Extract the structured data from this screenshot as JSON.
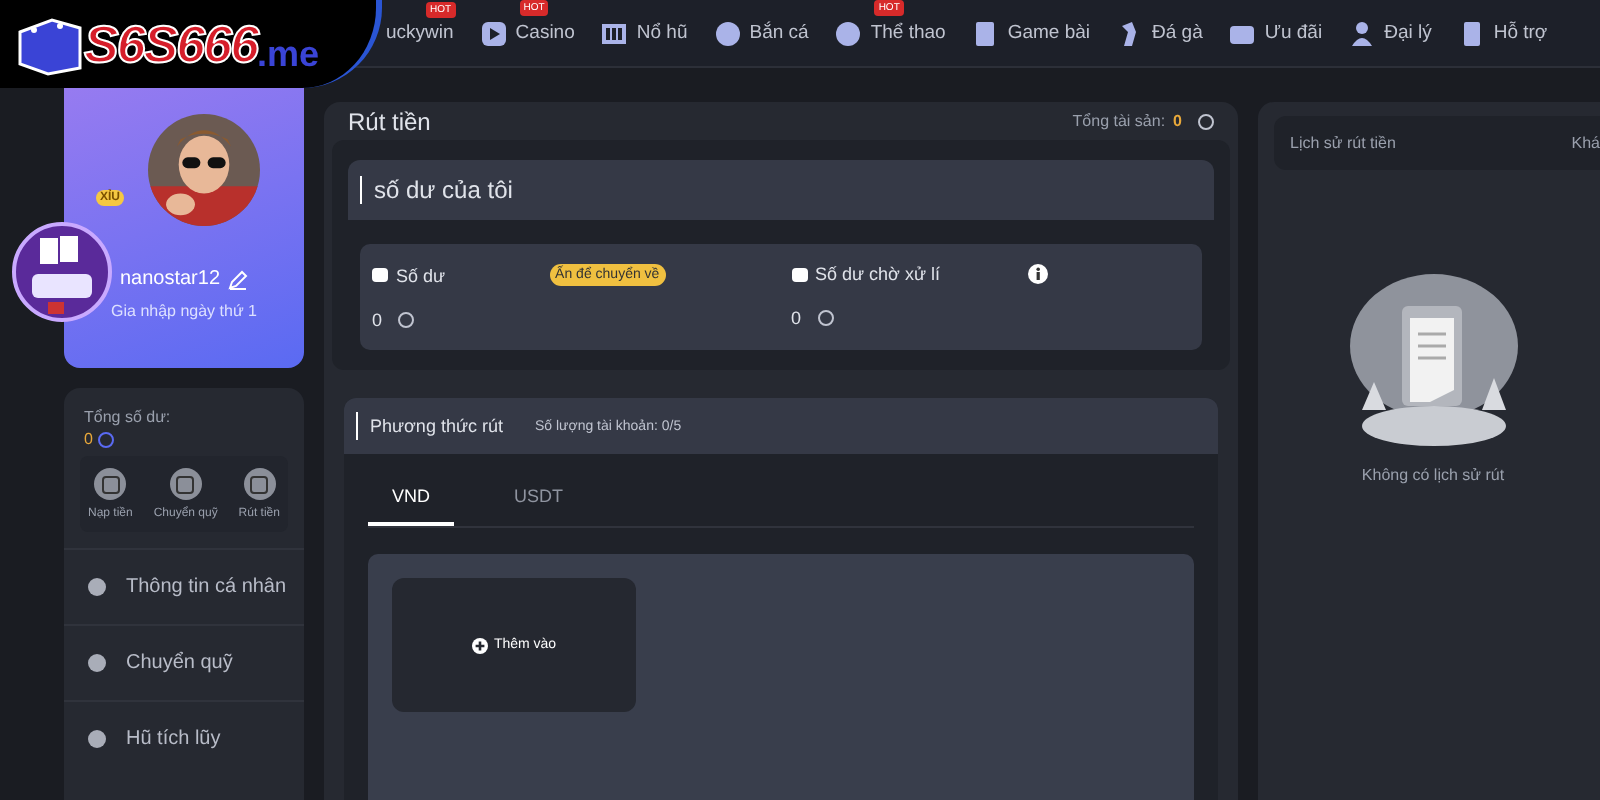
{
  "logo": {
    "text": "S6S666",
    "suffix": ".me"
  },
  "nav": [
    {
      "label": "uckywin",
      "hot": true,
      "badge": "HOT"
    },
    {
      "label": "Casino",
      "hot": true,
      "badge": "HOT"
    },
    {
      "label": "Nổ hũ",
      "hot": false
    },
    {
      "label": "Bắn cá",
      "hot": false
    },
    {
      "label": "Thể thao",
      "hot": true,
      "badge": "HOT"
    },
    {
      "label": "Game bài",
      "hot": false
    },
    {
      "label": "Đá gà",
      "hot": false
    },
    {
      "label": "Ưu đãi",
      "hot": false
    },
    {
      "label": "Đại lý",
      "hot": false
    },
    {
      "label": "Hỗ trợ",
      "hot": false
    }
  ],
  "profile": {
    "username": "nanostar12",
    "joined": "Gia nhập ngày thứ 1",
    "badge": "XỈU"
  },
  "balance": {
    "label": "Tổng số dư:",
    "value": "0"
  },
  "actions": [
    "Nạp tiền",
    "Chuyển quỹ",
    "Rút tiền"
  ],
  "menu": [
    "Thông tin cá nhân",
    "Chuyển quỹ",
    "Hũ tích lũy"
  ],
  "main": {
    "title": "Rút tiền",
    "total_label": "Tổng tài sản:",
    "total_value": "0",
    "my_balance": {
      "title": "số dư của tôi",
      "balance_label": "Số dư",
      "balance_value": "0",
      "transfer_button": "Ấn để chuyển về",
      "pending_label": "Số dư chờ xử lí",
      "pending_value": "0"
    },
    "methods": {
      "title": "Phương thức rút",
      "count": "Số lượng tài khoản:  0/5",
      "tabs": [
        {
          "label": "VND",
          "selected": true
        },
        {
          "label": "USDT",
          "selected": false
        }
      ],
      "add_button": "Thêm vào"
    }
  },
  "history": {
    "title": "Lịch sử rút tiền",
    "column_2": "Khá",
    "empty": "Không có lịch sử rút"
  }
}
